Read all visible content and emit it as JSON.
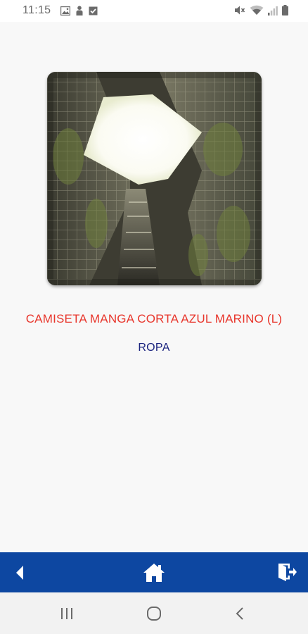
{
  "status_bar": {
    "time": "11:15",
    "left_icons": [
      "image-icon",
      "person-icon",
      "checkbox-icon"
    ],
    "right_icons": [
      "mute-icon",
      "wifi-icon",
      "signal-icon",
      "battery-icon"
    ]
  },
  "product": {
    "name": "CAMISETA MANGA CORTA AZUL MARINO (L)",
    "category": "ROPA",
    "image": "building-courtyard-photo"
  },
  "action_bar": {
    "buttons": [
      "back-arrow-icon",
      "home-icon",
      "exit-icon"
    ]
  },
  "nav_bar": {
    "buttons": [
      "recents-icon",
      "home-circle-icon",
      "back-chevron-icon"
    ]
  },
  "colors": {
    "title_red": "#e8362c",
    "category_navy": "#1a237e",
    "action_bar_blue": "#0d47a1"
  }
}
